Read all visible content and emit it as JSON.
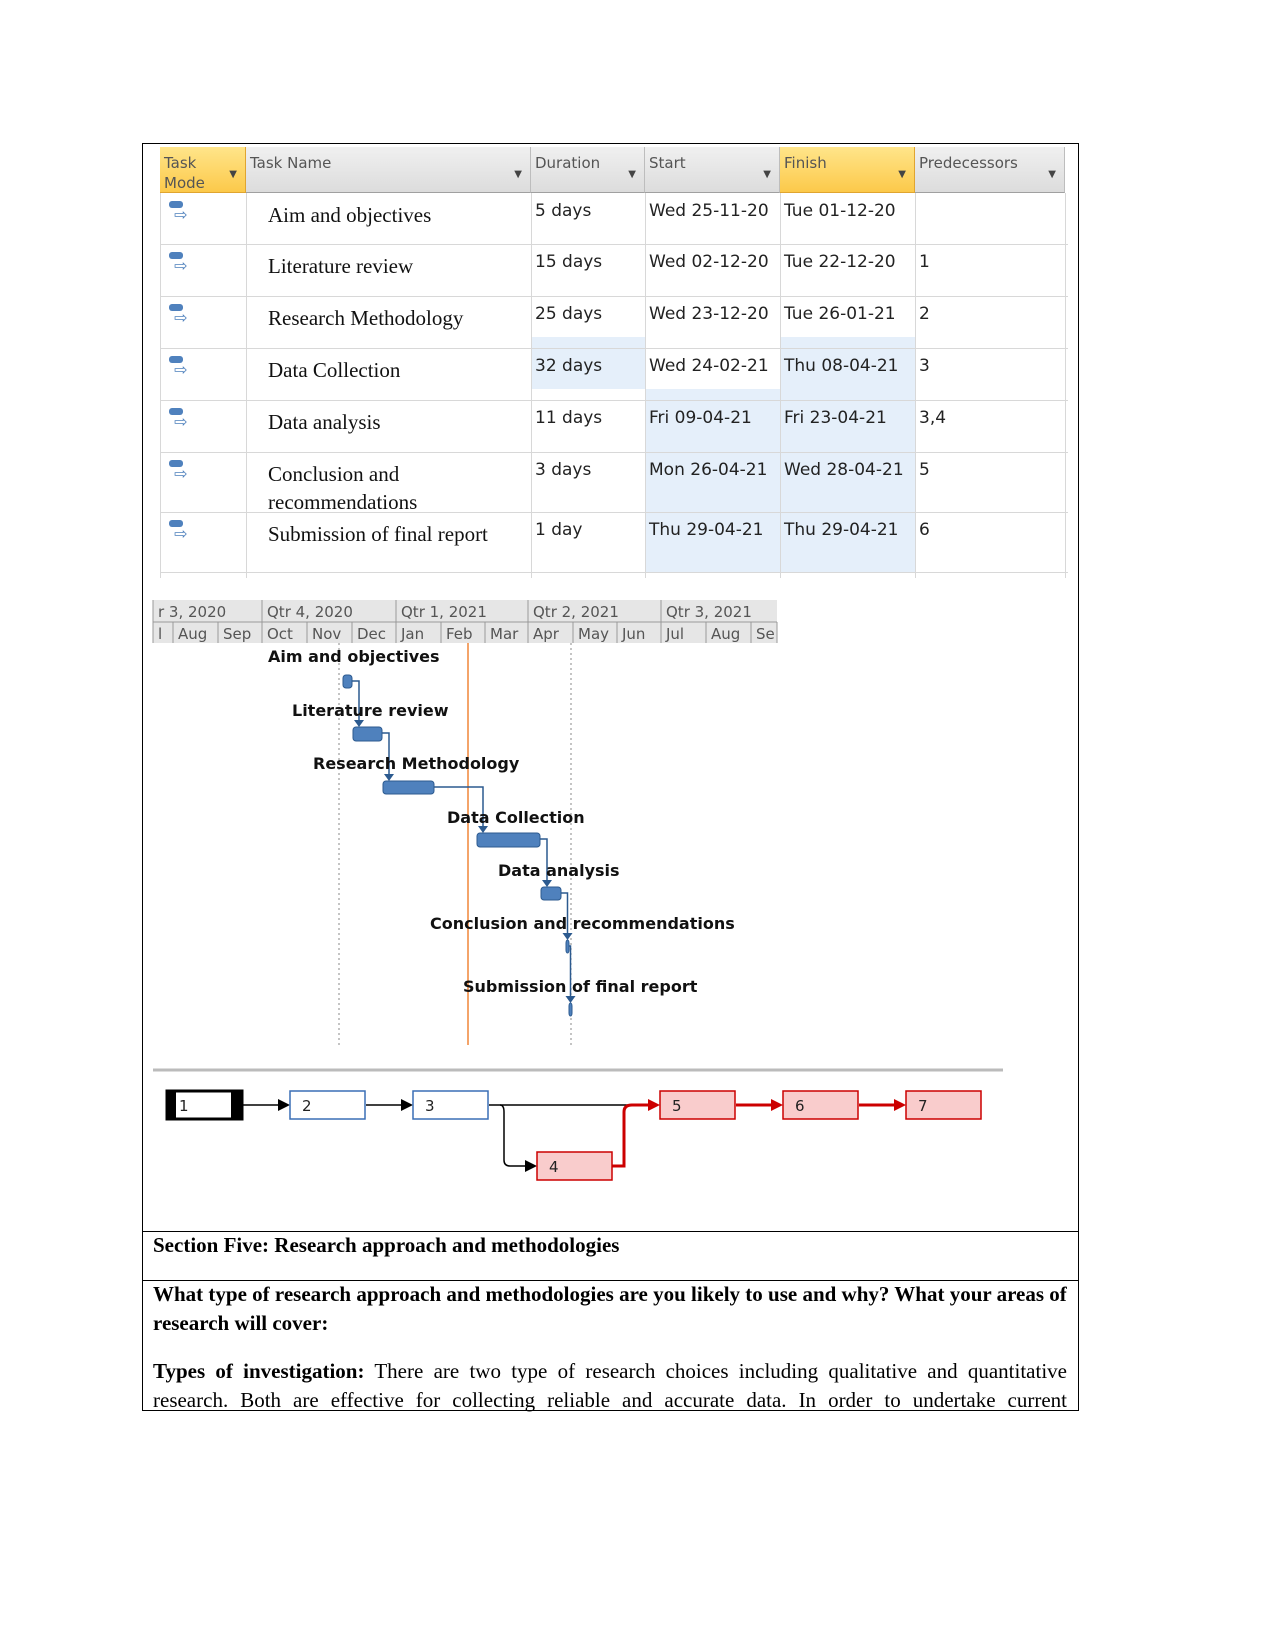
{
  "table": {
    "columns": [
      "Task Mode",
      "Task Name",
      "Duration",
      "Start",
      "Finish",
      "Predecessors"
    ],
    "rows": [
      {
        "name": "Aim and objectives",
        "duration": "5 days",
        "start": "Wed 25-11-20",
        "finish": "Tue 01-12-20",
        "pred": ""
      },
      {
        "name": "Literature review",
        "duration": "15 days",
        "start": "Wed 02-12-20",
        "finish": "Tue 22-12-20",
        "pred": "1"
      },
      {
        "name": "Research Methodology",
        "duration": "25 days",
        "start": "Wed 23-12-20",
        "finish": "Tue 26-01-21",
        "pred": "2"
      },
      {
        "name": "Data Collection",
        "duration": "32 days",
        "start": "Wed 24-02-21",
        "finish": "Thu 08-04-21",
        "pred": "3"
      },
      {
        "name": "Data analysis",
        "duration": "11 days",
        "start": "Fri 09-04-21",
        "finish": "Fri 23-04-21",
        "pred": "3,4"
      },
      {
        "name": "Conclusion and recommendations",
        "duration": "3 days",
        "start": "Mon 26-04-21",
        "finish": "Wed 28-04-21",
        "pred": "5"
      },
      {
        "name": "Submission of final report",
        "duration": "1 day",
        "start": "Thu 29-04-21",
        "finish": "Thu 29-04-21",
        "pred": "6"
      }
    ],
    "task_mode_icon": "auto-scheduled-task-icon",
    "accent_header": "#fcc94a"
  },
  "gantt": {
    "quarters": [
      "r 3, 2020",
      "Qtr 4, 2020",
      "Qtr 1, 2021",
      "Qtr 2, 2021",
      "Qtr 3, 2021"
    ],
    "months": [
      "l",
      "Aug",
      "Sep",
      "Oct",
      "Nov",
      "Dec",
      "Jan",
      "Feb",
      "Mar",
      "Apr",
      "May",
      "Jun",
      "Jul",
      "Aug",
      "Se"
    ],
    "labels": [
      "Aim and objectives",
      "Literature review",
      "Research Methodology",
      "Data Collection",
      "Data analysis",
      "Conclusion and recommendations",
      "Submission of final report"
    ],
    "bar_color": "#4f81bd",
    "today_line_color": "#f4a46a"
  },
  "network": {
    "nodes": [
      "1",
      "2",
      "3",
      "4",
      "5",
      "6",
      "7"
    ],
    "critical_color": "#cc0000",
    "critical_fill": "#f9cccc"
  },
  "document": {
    "section_heading": "Section Five: Research approach and methodologies",
    "question": "What type of research approach and methodologies are you likely to use and why? What your areas of research will cover:",
    "para_label": "Types of investigation:",
    "para_line1": " There are two type of research choices including qualitative and quantitative",
    "para_line2": "research. Both are effective for collecting reliable and accurate data. In order to undertake current"
  }
}
